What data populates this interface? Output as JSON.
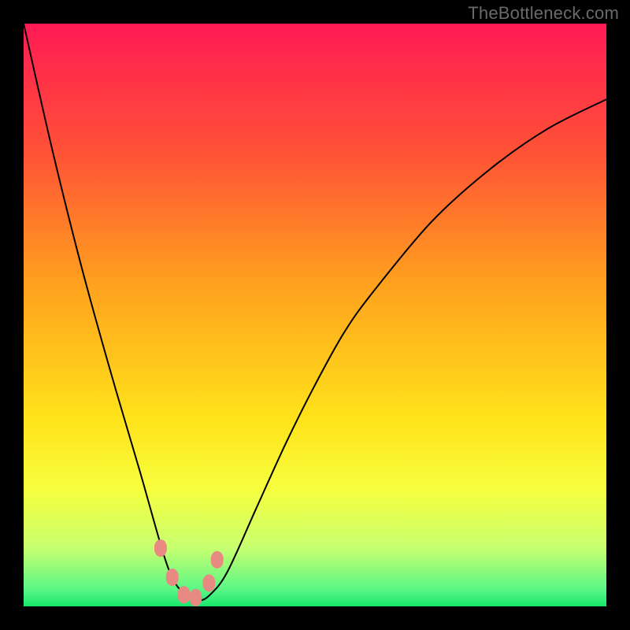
{
  "watermark": "TheBottleneck.com",
  "chart_data": {
    "type": "line",
    "title": "",
    "xlabel": "",
    "ylabel": "",
    "xlim": [
      0,
      100
    ],
    "ylim": [
      0,
      100
    ],
    "grid": false,
    "legend": false,
    "background_gradient": {
      "stops": [
        {
          "pct": 0,
          "color": "#ff1a55"
        },
        {
          "pct": 22,
          "color": "#ff5236"
        },
        {
          "pct": 45,
          "color": "#ffa21e"
        },
        {
          "pct": 68,
          "color": "#ffe31a"
        },
        {
          "pct": 80,
          "color": "#f6ff3f"
        },
        {
          "pct": 90,
          "color": "#c7ff70"
        },
        {
          "pct": 97,
          "color": "#5cf785"
        },
        {
          "pct": 100,
          "color": "#17e86e"
        }
      ]
    },
    "series": [
      {
        "name": "curve",
        "color": "#000000",
        "x": [
          0,
          5,
          10,
          15,
          20,
          24,
          26,
          28,
          30,
          32,
          35,
          40,
          45,
          50,
          55,
          60,
          70,
          80,
          90,
          100
        ],
        "y": [
          100,
          78,
          58,
          40,
          23,
          9,
          4,
          2,
          1,
          2,
          6,
          17,
          28,
          38,
          47,
          54,
          66,
          75,
          82,
          87
        ]
      }
    ],
    "markers": {
      "name": "highlighted-points",
      "color": "#e98a82",
      "x": [
        23.5,
        25.5,
        27.5,
        29.5,
        31.8,
        33.2
      ],
      "y": [
        10,
        5,
        2,
        1.5,
        4,
        8
      ]
    },
    "notes": "Axis values are unlabeled in the original image; x and y are normalized 0–100. The curve minimum (best match point) occurs near x≈29."
  }
}
